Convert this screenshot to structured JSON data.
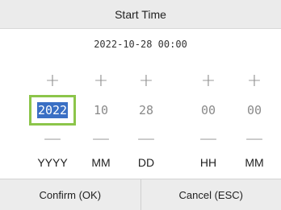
{
  "dialog": {
    "title": "Start Time",
    "current_value": "2022-10-28 00:00"
  },
  "fields": [
    {
      "value": "2022",
      "unit": "YYYY",
      "plus": "+",
      "minus": "—",
      "active": true
    },
    {
      "value": "10",
      "unit": "MM",
      "plus": "+",
      "minus": "—",
      "active": false
    },
    {
      "value": "28",
      "unit": "DD",
      "plus": "+",
      "minus": "—",
      "active": false
    },
    {
      "value": "00",
      "unit": "HH",
      "plus": "+",
      "minus": "—",
      "active": false
    },
    {
      "value": "00",
      "unit": "MM",
      "plus": "+",
      "minus": "—",
      "active": false
    }
  ],
  "buttons": {
    "confirm": "Confirm (OK)",
    "cancel": "Cancel (ESC)"
  },
  "colors": {
    "focus_border": "#8cc54a",
    "selection": "#3a6fc4"
  }
}
